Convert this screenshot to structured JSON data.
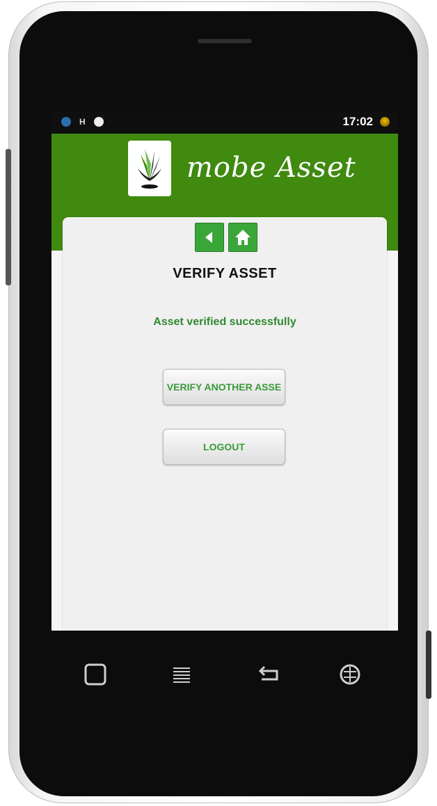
{
  "statusbar": {
    "time": "17:02",
    "h_indicator": "H"
  },
  "header": {
    "app_title": "mobe Asset"
  },
  "card": {
    "title": "VERIFY ASSET",
    "message": "Asset verified successfully",
    "verify_another_label": "VERIFY ANOTHER ASSE",
    "logout_label": "LOGOUT"
  },
  "icons": {
    "back": "back-arrow-icon",
    "home": "home-icon",
    "nav_home": "square-home-icon",
    "menu": "menu-icon",
    "back_key": "return-arrow-icon",
    "search_key": "search-globe-icon"
  },
  "colors": {
    "header_green": "#3f8a0f",
    "message_green": "#2f8a2f",
    "button_text_green": "#3a9a3a"
  }
}
